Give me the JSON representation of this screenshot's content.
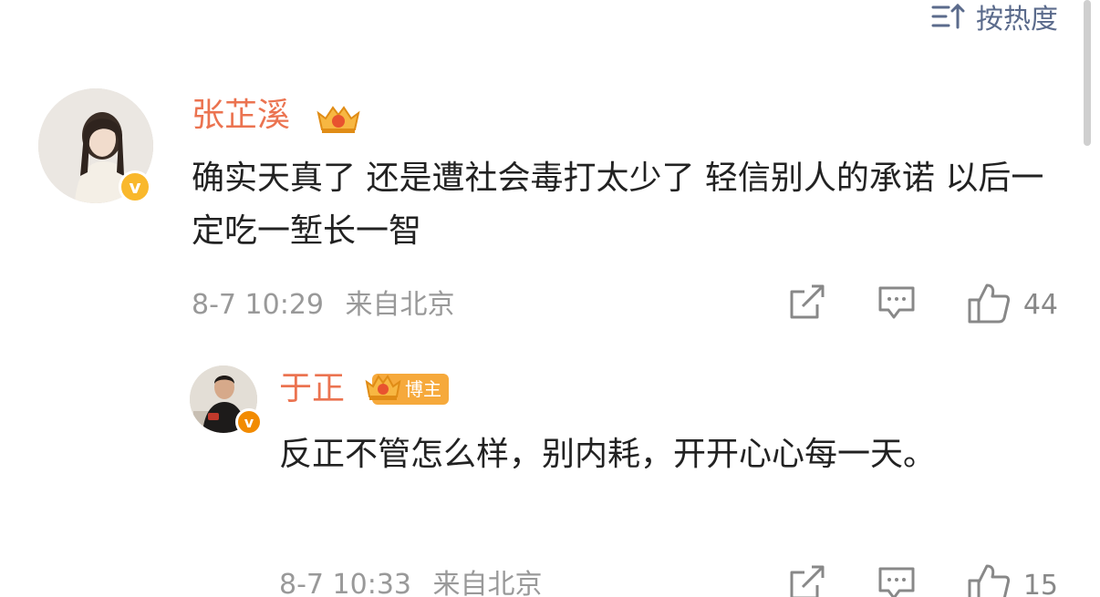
{
  "sort": {
    "label": "按热度"
  },
  "comments": [
    {
      "user": {
        "name": "张芷溪",
        "verified_mark": "v"
      },
      "text": "确实天真了 还是遭社会毒打太少了 轻信别人的承诺 以后一定吃一堑长一智",
      "date": "8-7 10:29",
      "location": "来自北京",
      "likes": "44"
    },
    {
      "user": {
        "name": "于正",
        "verified_mark": "v",
        "badge": "博主"
      },
      "text": "反正不管怎么样，别内耗，开开心心每一天。",
      "date": "8-7 10:33",
      "location": "来自北京",
      "likes": "15"
    }
  ],
  "colors": {
    "username": "#eb7350",
    "sort": "#5b6b8c",
    "meta": "#999999",
    "verified": "#f9b82c"
  },
  "icons": [
    "sort-icon",
    "crown-icon",
    "repost-icon",
    "comment-icon",
    "like-icon"
  ]
}
